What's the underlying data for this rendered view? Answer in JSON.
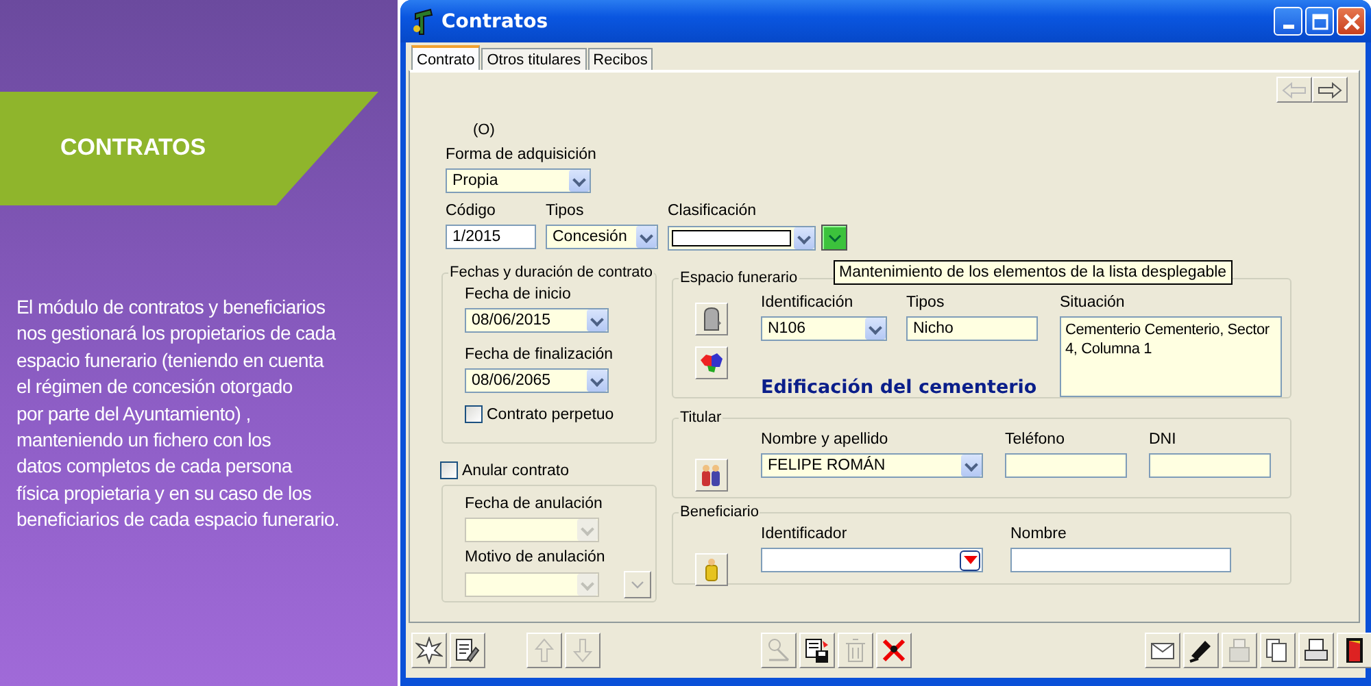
{
  "sidebar": {
    "heading": "CONTRATOS",
    "description": "El módulo de contratos y beneficiarios\nnos gestionará los propietarios de cada\nespacio funerario (teniendo en cuenta\nel régimen de concesión otorgado\npor parte del Ayuntamiento) ,\nmanteniendo un fichero con los\ndatos completos de cada persona\nfísica propietaria y en su caso de los\nbeneficiarios de cada espacio funerario."
  },
  "window": {
    "title": "Contratos"
  },
  "tabs": [
    {
      "label": "Contrato",
      "selected": true
    },
    {
      "label": "Otros titulares",
      "selected": false
    },
    {
      "label": "Recibos",
      "selected": false
    }
  ],
  "record_nav": [
    {
      "kind": "previous",
      "disabled": true
    },
    {
      "kind": "next",
      "disabled": false
    }
  ],
  "record_counter": "(O)",
  "forma_de_adquisicion": {
    "label": "Forma de adquisición",
    "value": "Propia"
  },
  "codigo": {
    "label": "Código",
    "value": "1/2015"
  },
  "tipos": {
    "label": "Tipos",
    "value": "Concesión"
  },
  "clasificacion": {
    "label": "Clasificación"
  },
  "tooltip": "Mantenimiento de los elementos de la lista desplegable",
  "fechas": {
    "title": "Fechas y duración de contrato",
    "inicio": {
      "label": "Fecha de inicio",
      "value": "08/06/2015"
    },
    "finalizacion": {
      "label": "Fecha de finalización",
      "value": "08/06/2065"
    },
    "perpetuo": {
      "label": "Contrato perpetuo",
      "checked": false
    }
  },
  "anulacion": {
    "label": "Anular contrato",
    "checked": false,
    "fecha": {
      "label": "Fecha de anulación",
      "disabled": true
    },
    "motivo": {
      "label": "Motivo de anulación",
      "disabled": true
    }
  },
  "espacio_funerario": {
    "title": "Espacio funerario",
    "identificacion": {
      "label": "Identificación",
      "value": "N106"
    },
    "tipos": {
      "label": "Tipos",
      "value": "Nicho"
    },
    "situacion": {
      "label": "Situación",
      "value": "Cementerio Cementerio, Sector 4, Columna 1"
    },
    "link": "Edificación del cementerio"
  },
  "titular": {
    "title": "Titular",
    "nombre": {
      "label": "Nombre y apellido",
      "value": "FELIPE ROMÁN"
    },
    "telefono": {
      "label": "Teléfono"
    },
    "dni": {
      "label": "DNI"
    }
  },
  "beneficiario": {
    "title": "Beneficiario",
    "identificador": {
      "label": "Identificador"
    },
    "nombre": {
      "label": "Nombre"
    }
  },
  "toolbar": [
    {
      "buttons": [
        {
          "kind": "new",
          "disabled": false
        },
        {
          "kind": "edit",
          "disabled": false
        }
      ]
    },
    {
      "buttons": [
        {
          "kind": "up",
          "disabled": true
        },
        {
          "kind": "down",
          "disabled": true
        }
      ]
    },
    {
      "buttons": [
        {
          "kind": "tool",
          "disabled": true
        },
        {
          "kind": "save",
          "disabled": false
        },
        {
          "kind": "trash",
          "disabled": true
        },
        {
          "kind": "delete",
          "disabled": false
        }
      ]
    },
    {
      "buttons": [
        {
          "kind": "mail",
          "disabled": false
        },
        {
          "kind": "pen",
          "disabled": false
        },
        {
          "kind": "fax",
          "disabled": true
        },
        {
          "kind": "copy",
          "disabled": false
        },
        {
          "kind": "print",
          "disabled": false
        },
        {
          "kind": "exit",
          "disabled": false
        }
      ]
    }
  ]
}
